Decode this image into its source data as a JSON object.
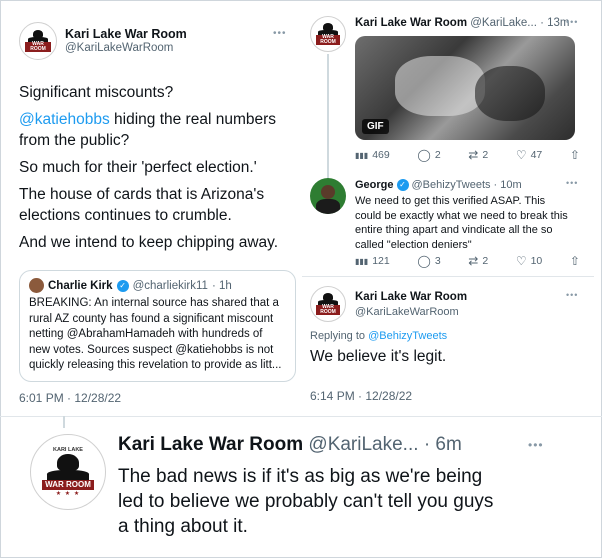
{
  "left_tweet": {
    "name": "Kari Lake War Room",
    "handle": "@KariLakeWarRoom",
    "avatar_band": "WAR ROOM",
    "lines": [
      "Significant miscounts?",
      "@katiehobbs",
      " hiding the real numbers",
      "from the public?",
      "So much for their 'perfect election.'",
      "The house of cards that is Arizona's",
      "elections continues to crumble.",
      "And we intend to keep chipping away."
    ],
    "quote": {
      "name": "Charlie Kirk",
      "handle": "@charliekirk11",
      "time": "· 1h",
      "text": "BREAKING: An internal source has shared that a rural AZ county has found a significant miscount netting @AbrahamHamadeh with hundreds of new votes. Sources suspect @katiehobbs is not quickly releasing this revelation to provide as litt..."
    },
    "timestamp": "6:01 PM · 12/28/22"
  },
  "right_top_tweet": {
    "name": "Kari Lake War Room",
    "handle": "@KariLake...",
    "time": "· 13m",
    "gif_label": "GIF",
    "stats": {
      "views": "469",
      "replies": "2",
      "retweets": "2",
      "likes": "47"
    }
  },
  "george_tweet": {
    "name": "George",
    "handle": "@BehizyTweets",
    "time": "· 10m",
    "lines": [
      "We need to get this verified ASAP. This",
      "could be exactly what we need to break this",
      "entire thing apart and vindicate all the so",
      "called \"election deniers\""
    ],
    "stats": {
      "views": "121",
      "replies": "3",
      "retweets": "2",
      "likes": "10"
    }
  },
  "reply_tweet": {
    "name": "Kari Lake War Room",
    "handle": "@KariLakeWarRoom",
    "replying_prefix": "Replying to",
    "replying_to": "@BehizyTweets",
    "text": "We believe it's legit.",
    "timestamp": "6:14 PM · 12/28/22"
  },
  "bottom_tweet": {
    "name": "Kari Lake War Room",
    "handle": "@KariLake...",
    "time": "· 6m",
    "avatar_top": "KARI LAKE",
    "avatar_band": "WAR ROOM",
    "lines": [
      "The bad news is if it's as big as we're being",
      "led to believe we probably can't tell you guys",
      "a thing about it."
    ]
  },
  "icons": {
    "more": "•••",
    "views": "▮▮▮",
    "reply": "◯",
    "retweet": "⇄",
    "like": "♡",
    "share": "⇧",
    "verified": "✓"
  }
}
